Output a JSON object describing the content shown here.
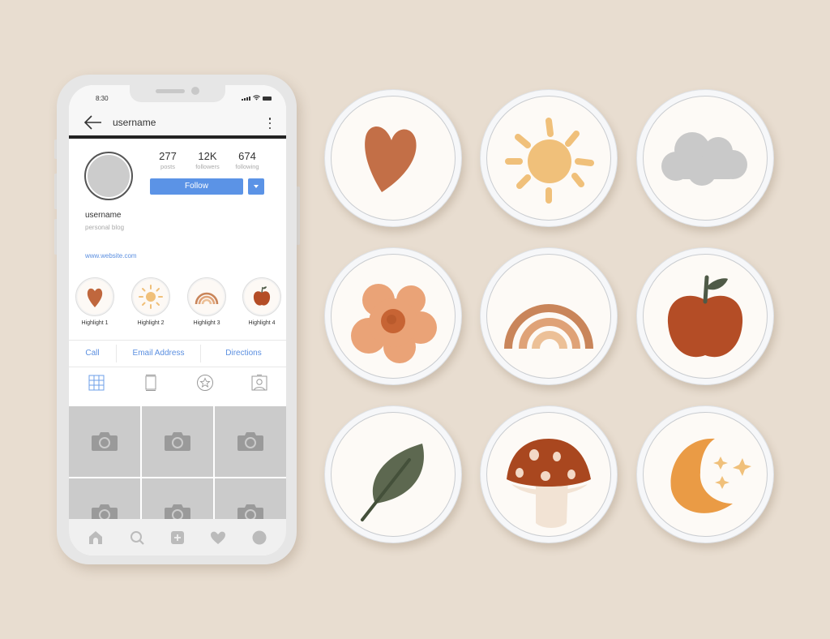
{
  "phone": {
    "status_bar": {
      "time": "8:30",
      "icons": [
        "signal-icon",
        "wifi-icon",
        "battery-icon"
      ]
    },
    "nav": {
      "back_icon": "arrow-left-icon",
      "title": "username",
      "menu_icon": "more-vertical-icon"
    },
    "profile": {
      "stats": [
        {
          "value": "277",
          "label": "posts"
        },
        {
          "value": "12K",
          "label": "followers"
        },
        {
          "value": "674",
          "label": "following"
        }
      ],
      "follow_label": "Follow",
      "name": "username",
      "bio": "personal blog",
      "website": "www.website.com"
    },
    "highlights": [
      {
        "label": "Highlight 1",
        "icon": "heart-icon"
      },
      {
        "label": "Highlight 2",
        "icon": "sun-icon"
      },
      {
        "label": "Highlight 3",
        "icon": "rainbow-icon"
      },
      {
        "label": "Highlight 4",
        "icon": "apple-icon"
      }
    ],
    "contact_buttons": [
      "Call",
      "Email Address",
      "Directions"
    ],
    "tabs": [
      {
        "icon": "grid-icon",
        "active": true
      },
      {
        "icon": "feed-icon",
        "active": false
      },
      {
        "icon": "star-icon",
        "active": false
      },
      {
        "icon": "tagged-user-icon",
        "active": false
      }
    ],
    "post_placeholders": 6,
    "bottom_nav": [
      "home-icon",
      "search-icon",
      "add-post-icon",
      "heart-icon",
      "profile-icon"
    ]
  },
  "highlight_covers": [
    {
      "name": "heart",
      "colors": [
        "#c0673d"
      ]
    },
    {
      "name": "sun",
      "colors": [
        "#f0c07a"
      ]
    },
    {
      "name": "cloud",
      "colors": [
        "#c9c9c9"
      ]
    },
    {
      "name": "flower",
      "colors": [
        "#eaa377",
        "#c76434"
      ]
    },
    {
      "name": "rainbow",
      "colors": [
        "#c9855a",
        "#dfa277",
        "#ecc097"
      ]
    },
    {
      "name": "apple",
      "colors": [
        "#b44d26",
        "#4f5a47"
      ]
    },
    {
      "name": "leaf",
      "colors": [
        "#5d6850"
      ]
    },
    {
      "name": "mushroom",
      "colors": [
        "#a9471f",
        "#f2e3d4"
      ]
    },
    {
      "name": "moon",
      "colors": [
        "#ea9b45",
        "#f0c07a"
      ]
    }
  ],
  "colors": {
    "background": "#e8ddd0",
    "accent": "#5b93e6",
    "link": "#5b8fe0"
  }
}
